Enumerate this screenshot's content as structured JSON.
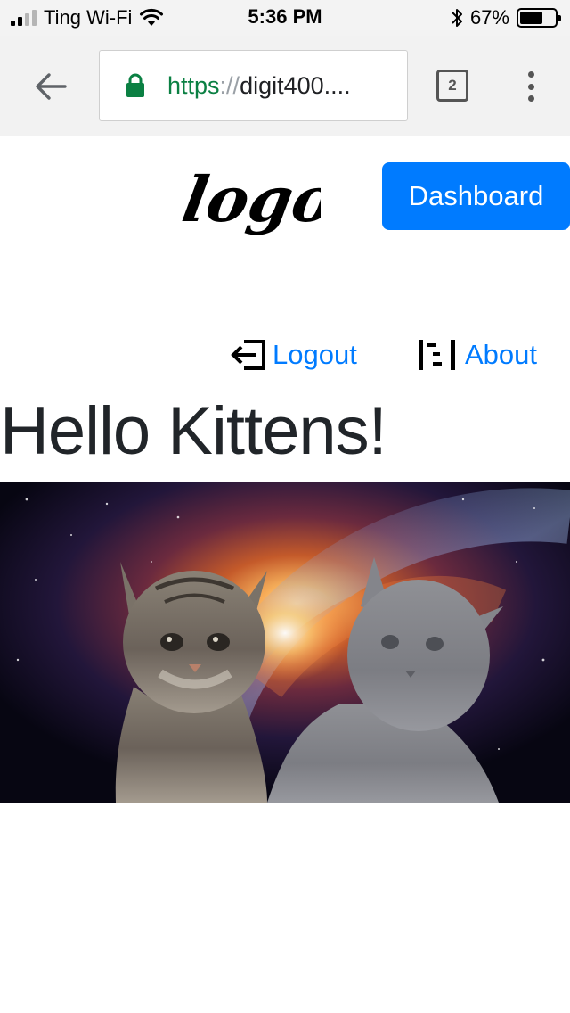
{
  "status_bar": {
    "carrier": "Ting Wi-Fi",
    "time": "5:36 PM",
    "battery_percent": "67%",
    "battery_level": 0.67,
    "signal_bars_filled": 2
  },
  "browser": {
    "url_scheme": "https",
    "url_sep": "://",
    "url_host": "digit400....",
    "tab_count": "2"
  },
  "page": {
    "logo_text": "logo",
    "dashboard_label": "Dashboard",
    "nav": {
      "logout_label": "Logout",
      "about_label": "About"
    },
    "title": "Hello Kittens!"
  },
  "colors": {
    "primary": "#007bff",
    "secure": "#0b8043",
    "text": "#212529"
  },
  "icons": {
    "back": "arrow-left-icon",
    "lock": "lock-icon",
    "tabs": "tabs-icon",
    "menu": "more-vertical-icon",
    "logout": "sign-out-icon",
    "about": "info-list-icon",
    "wifi": "wifi-icon",
    "bluetooth": "bluetooth-icon"
  }
}
